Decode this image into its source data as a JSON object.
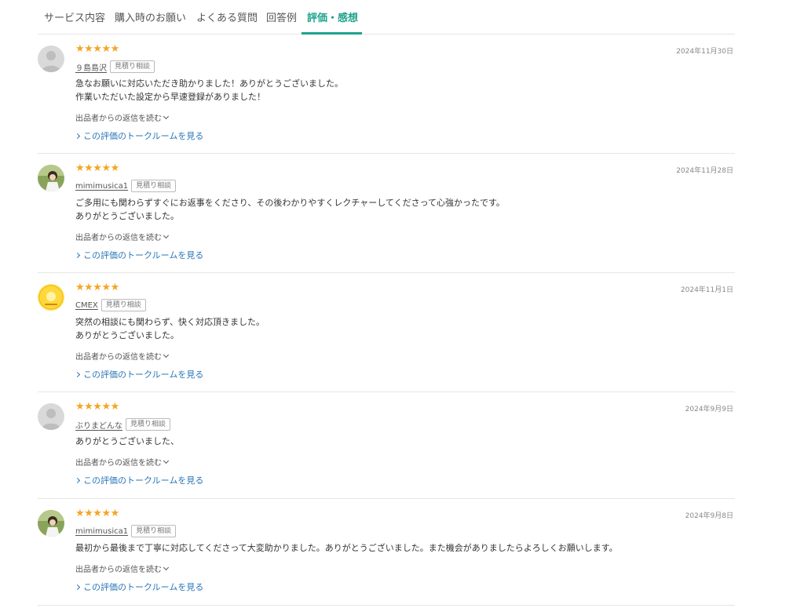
{
  "tabs": [
    {
      "label": "サービス内容"
    },
    {
      "label": "購入時のお願い"
    },
    {
      "label": "よくある質問"
    },
    {
      "label": "回答例"
    },
    {
      "label": "評価・感想"
    }
  ],
  "reviews": [
    {
      "stars": "★★★★★",
      "rating": 5,
      "username": "９島島沢",
      "badge": "見積り相談",
      "date": "2024年11月30日",
      "text_lines": [
        "急なお願いに対応いただき助かりました！ありがとうございました。",
        "作業いただいた設定から早速登録がありました！"
      ],
      "reply_toggle": "出品者からの返信を読む",
      "room_link": "この評価のトークルームを見る"
    },
    {
      "stars": "★★★★★",
      "rating": 5,
      "username": "mimimusica1",
      "badge": "見積り相談",
      "date": "2024年11月28日",
      "text_lines": [
        "ご多用にも関わらずすぐにお返事をくださり、その後わかりやすくレクチャーしてくださって心強かったです。",
        "ありがとうございました。"
      ],
      "reply_toggle": "出品者からの返信を読む",
      "room_link": "この評価のトークルームを見る"
    },
    {
      "stars": "★★★★★",
      "rating": 5,
      "username": "CMEX",
      "badge": "見積り相談",
      "date": "2024年11月1日",
      "text_lines": [
        "突然の相談にも関わらず、快く対応頂きました。",
        "ありがとうございました。"
      ],
      "reply_toggle": "出品者からの返信を読む",
      "room_link": "この評価のトークルームを見る"
    },
    {
      "stars": "★★★★★",
      "rating": 5,
      "username": "ぶりまどんな",
      "badge": "見積り相談",
      "date": "2024年9月9日",
      "text_lines": [
        "ありがとうございました、"
      ],
      "reply_toggle": "出品者からの返信を読む",
      "room_link": "この評価のトークルームを見る"
    },
    {
      "stars": "★★★★★",
      "rating": 5,
      "username": "mimimusica1",
      "badge": "見積り相談",
      "date": "2024年9月8日",
      "text_lines": [
        "最初から最後まで丁寧に対応してくださって大変助かりました。ありがとうございました。また機会がありましたらよろしくお願いします。"
      ],
      "reply_toggle": "出品者からの返信を読む",
      "room_link": "この評価のトークルームを見る"
    }
  ],
  "colors": {
    "accent": "#1fa38c",
    "star": "#f4a623",
    "link": "#2a76b8"
  },
  "icons": {
    "default_avatar": "person-silhouette-icon",
    "photo_avatar": "user-photo",
    "logo_avatar": "cmex-logo"
  }
}
